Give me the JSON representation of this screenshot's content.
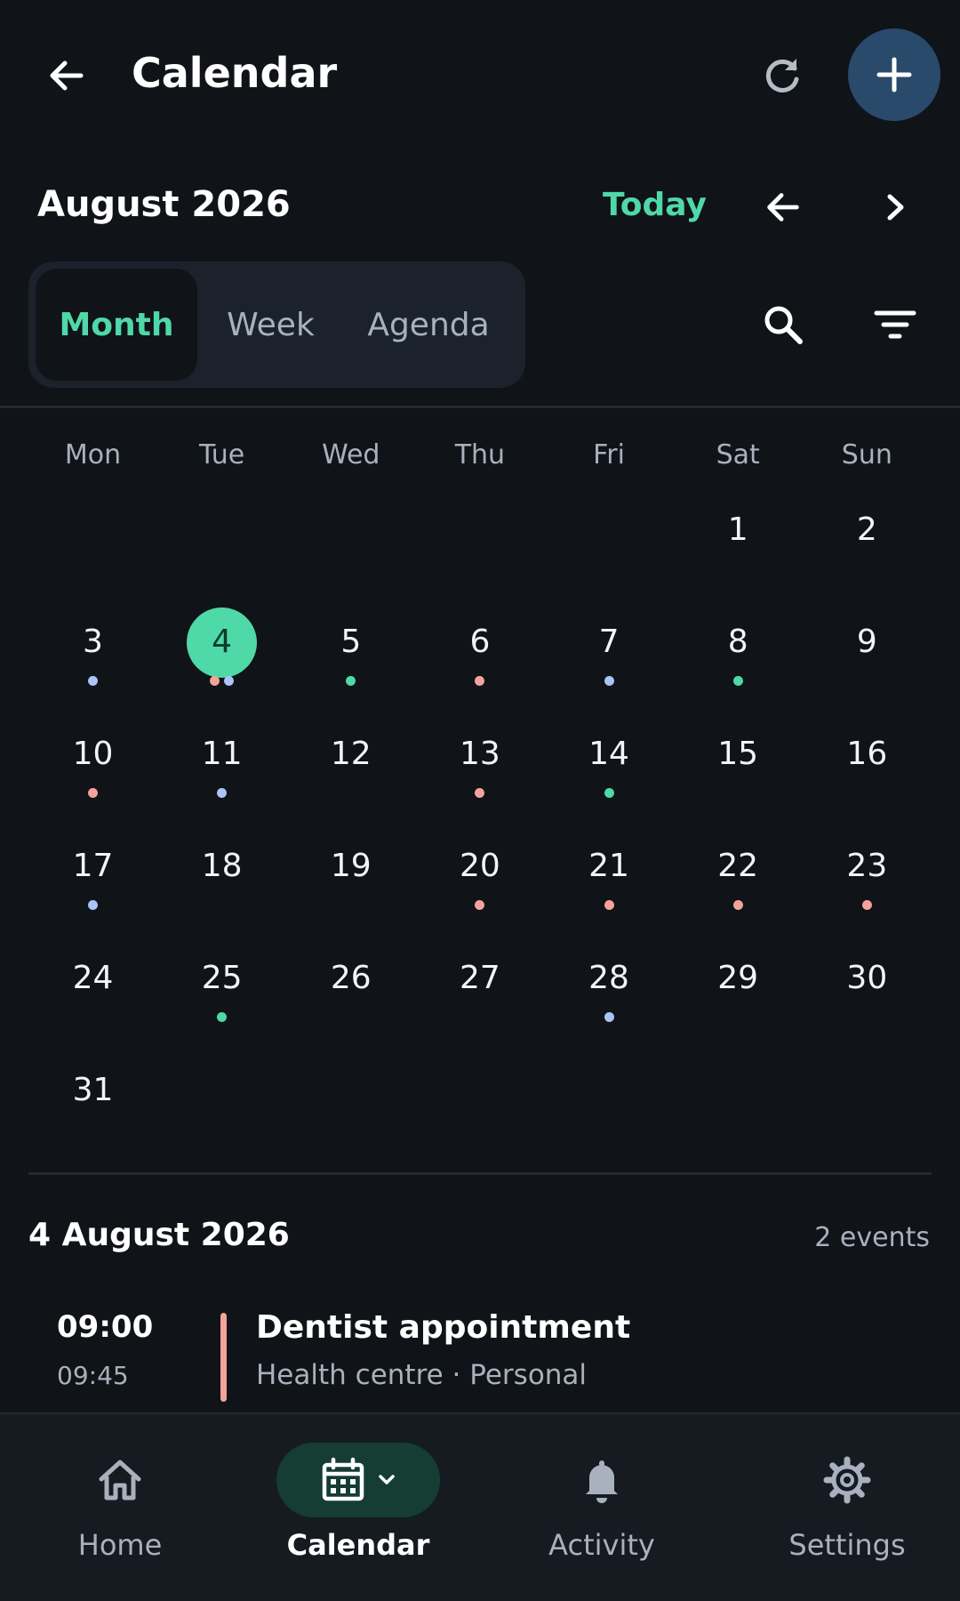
{
  "header": {
    "title": "Calendar",
    "icons": {
      "back": "arrow-left-icon",
      "refresh": "refresh-icon",
      "add": "plus-icon"
    }
  },
  "nav": {
    "month_label": "August 2026",
    "today_label": "Today",
    "icons": {
      "prev": "arrow-left-icon",
      "next": "chevron-right-icon",
      "search": "search-icon",
      "filter": "filter-icon"
    }
  },
  "views": [
    {
      "label": "Month",
      "active": true
    },
    {
      "label": "Week",
      "active": false
    },
    {
      "label": "Agenda",
      "active": false
    }
  ],
  "calendar": {
    "weekdays": [
      "Mon",
      "Tue",
      "Wed",
      "Thu",
      "Fri",
      "Sat",
      "Sun"
    ],
    "selected_day": "4",
    "weeks": [
      [
        null,
        null,
        null,
        null,
        null,
        {
          "day": "1",
          "dots": []
        },
        {
          "day": "2",
          "dots": []
        }
      ],
      [
        {
          "day": "3",
          "dots": [
            "blue"
          ]
        },
        {
          "day": "4",
          "dots": [
            "red",
            "blue"
          ]
        },
        {
          "day": "5",
          "dots": [
            "green"
          ]
        },
        {
          "day": "6",
          "dots": [
            "red"
          ]
        },
        {
          "day": "7",
          "dots": [
            "blue"
          ]
        },
        {
          "day": "8",
          "dots": [
            "green"
          ]
        },
        {
          "day": "9",
          "dots": []
        }
      ],
      [
        {
          "day": "10",
          "dots": [
            "red"
          ]
        },
        {
          "day": "11",
          "dots": [
            "blue"
          ]
        },
        {
          "day": "12",
          "dots": []
        },
        {
          "day": "13",
          "dots": [
            "red"
          ]
        },
        {
          "day": "14",
          "dots": [
            "green"
          ]
        },
        {
          "day": "15",
          "dots": []
        },
        {
          "day": "16",
          "dots": []
        }
      ],
      [
        {
          "day": "17",
          "dots": [
            "blue"
          ]
        },
        {
          "day": "18",
          "dots": []
        },
        {
          "day": "19",
          "dots": []
        },
        {
          "day": "20",
          "dots": [
            "red"
          ]
        },
        {
          "day": "21",
          "dots": [
            "red"
          ]
        },
        {
          "day": "22",
          "dots": [
            "red"
          ]
        },
        {
          "day": "23",
          "dots": [
            "red"
          ]
        }
      ],
      [
        {
          "day": "24",
          "dots": []
        },
        {
          "day": "25",
          "dots": [
            "green"
          ]
        },
        {
          "day": "26",
          "dots": []
        },
        {
          "day": "27",
          "dots": []
        },
        {
          "day": "28",
          "dots": [
            "blue"
          ]
        },
        {
          "day": "29",
          "dots": []
        },
        {
          "day": "30",
          "dots": []
        }
      ],
      [
        {
          "day": "31",
          "dots": []
        },
        null,
        null,
        null,
        null,
        null,
        null
      ]
    ]
  },
  "colors": {
    "accent": "#4fd8a8",
    "red": "#f4a39a",
    "blue": "#a9c4f5",
    "green": "#4fd8a8",
    "background": "#101318"
  },
  "day_detail": {
    "date_label": "4 August 2026",
    "count_label": "2 events",
    "events": [
      {
        "start": "09:00",
        "end": "09:45",
        "title": "Dentist appointment",
        "subtitle": "Health centre · Personal",
        "color": "#f4a39a"
      }
    ]
  },
  "bottom_nav": [
    {
      "label": "Home",
      "icon": "home-icon",
      "active": false
    },
    {
      "label": "Calendar",
      "icon": "calendar-icon",
      "active": true
    },
    {
      "label": "Activity",
      "icon": "bell-icon",
      "active": false
    },
    {
      "label": "Settings",
      "icon": "gear-icon",
      "active": false
    }
  ]
}
